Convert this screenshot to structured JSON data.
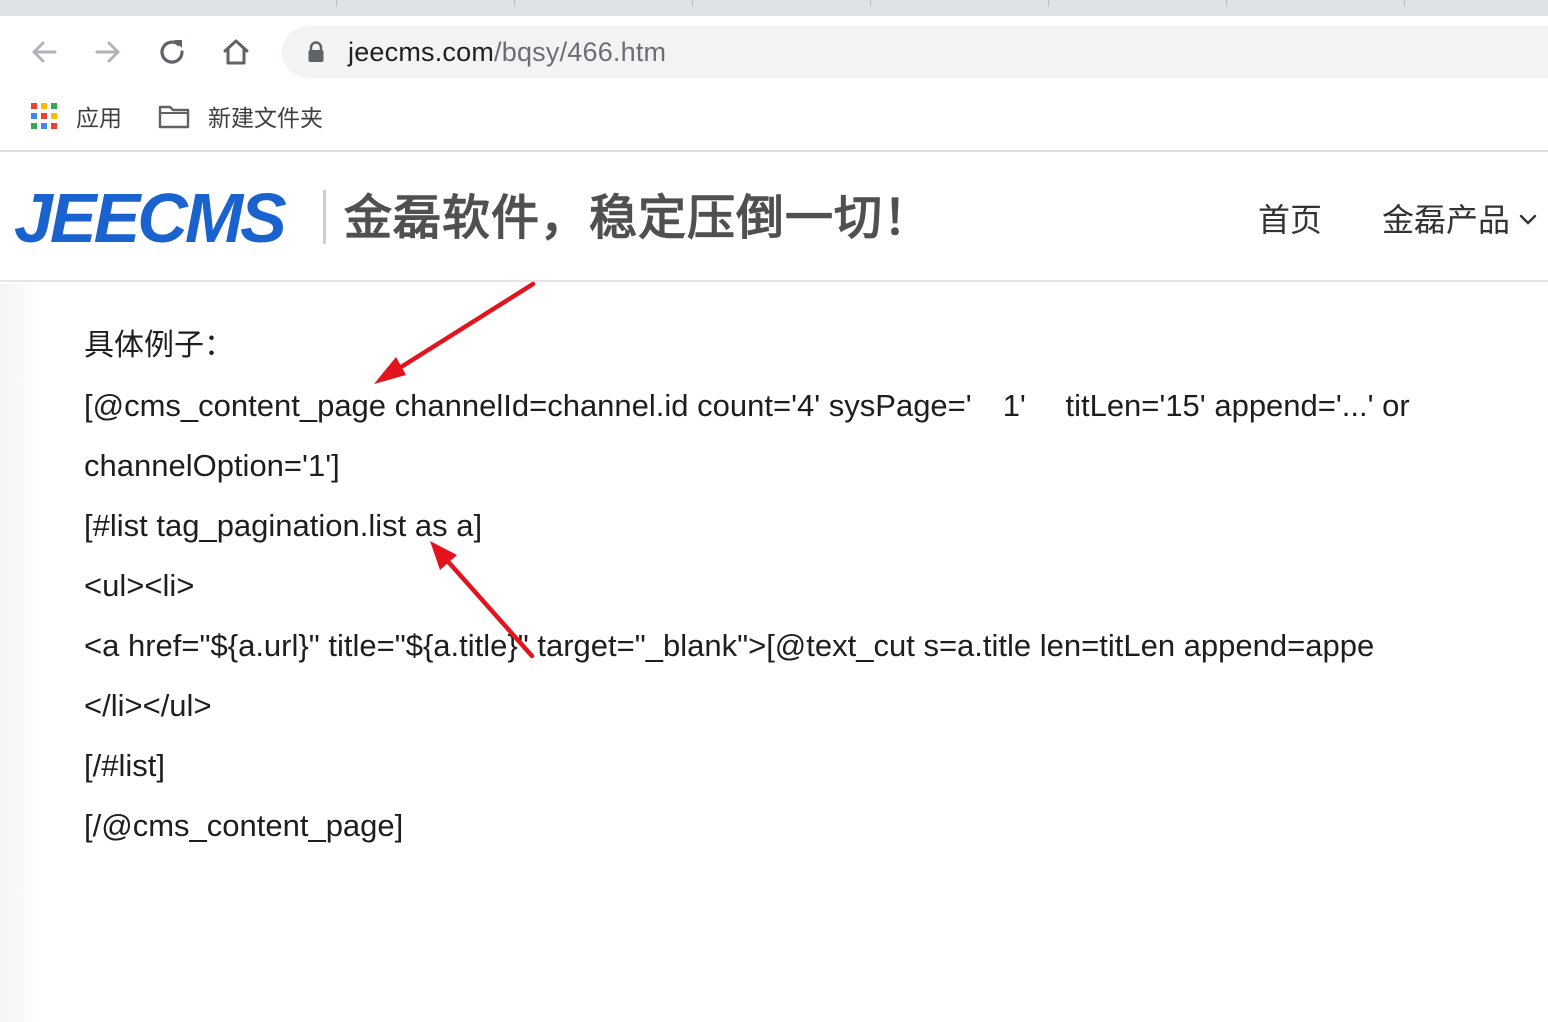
{
  "browser": {
    "url_host": "jeecms.com",
    "url_path": "/bqsy/466.htm",
    "bookmarks": [
      {
        "label": "应用",
        "icon": "apps-grid-icon"
      },
      {
        "label": "新建文件夹",
        "icon": "folder-icon"
      }
    ]
  },
  "site": {
    "logo": "JEECMS",
    "slogan": "金磊软件，稳定压倒一切！",
    "nav": {
      "home": "首页",
      "products": "金磊产品"
    }
  },
  "article": {
    "lines": [
      "具体例子：",
      "[@cms_content_page channelId=channel.id count='4' sysPage='　1'　 titLen='15' append='...' or",
      "channelOption='1']",
      "[#list tag_pagination.list as a]",
      "<ul><li>",
      "<a href=\"${a.url}\" title=\"${a.title}\" target=\"_blank\">[@text_cut s=a.title len=titLen append=appe",
      "</li></ul>",
      "[/#list]",
      "[/@cms_content_page]"
    ]
  },
  "colors": {
    "logo_blue": "#1a63cf",
    "annotation_red": "#e3141e"
  }
}
